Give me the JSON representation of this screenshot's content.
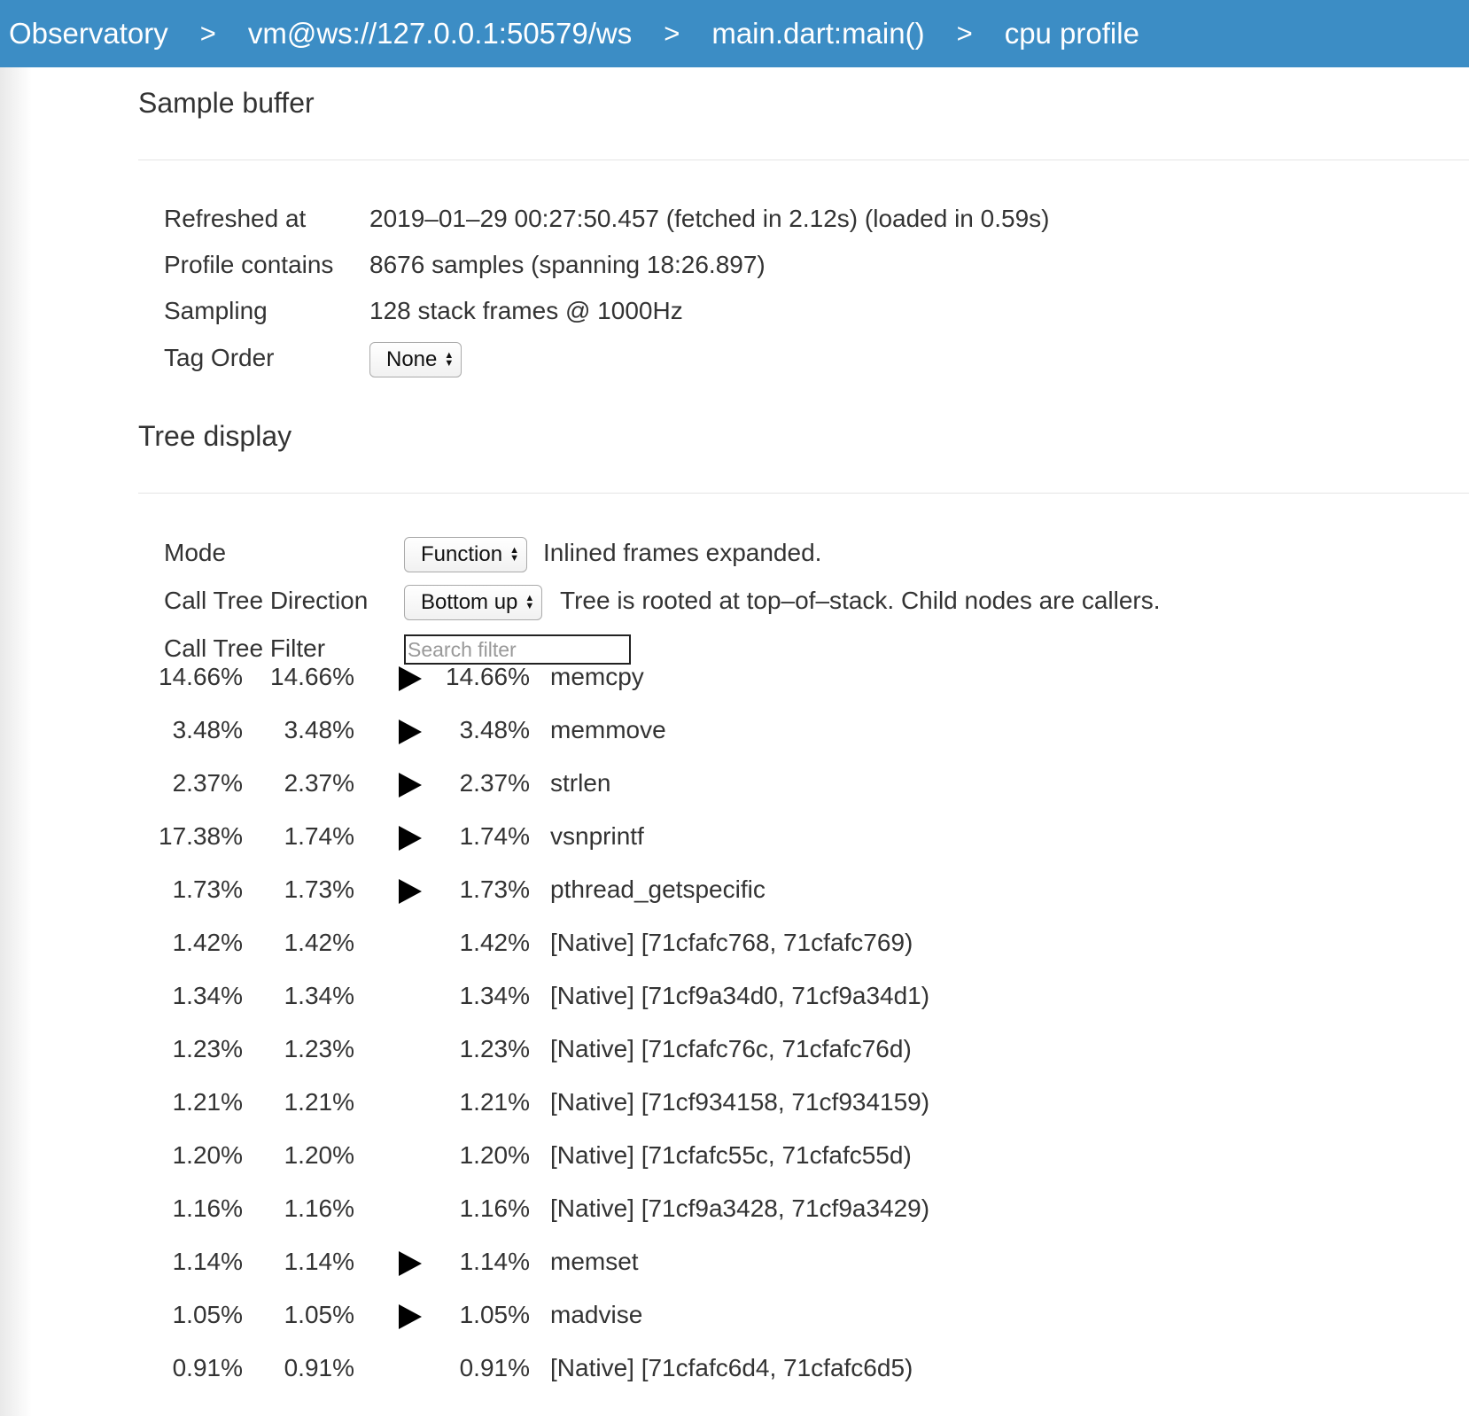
{
  "breadcrumb": {
    "items": [
      "Observatory",
      "vm@ws://127.0.0.1:50579/ws",
      "main.dart:main()",
      "cpu profile"
    ],
    "separator": ">"
  },
  "sample_buffer": {
    "title": "Sample buffer",
    "refreshed_label": "Refreshed at",
    "refreshed_value": "2019–01–29 00:27:50.457 (fetched in 2.12s) (loaded in 0.59s)",
    "contains_label": "Profile contains",
    "contains_value": "8676 samples (spanning 18:26.897)",
    "sampling_label": "Sampling",
    "sampling_value": "128 stack frames @ 1000Hz",
    "tag_order_label": "Tag Order",
    "tag_order_value": "None"
  },
  "tree_display": {
    "title": "Tree display",
    "mode_label": "Mode",
    "mode_value": "Function",
    "mode_note": "Inlined frames expanded.",
    "direction_label": "Call Tree Direction",
    "direction_value": "Bottom up",
    "direction_note": "Tree is rooted at top–of–stack. Child nodes are callers.",
    "filter_label": "Call Tree Filter",
    "filter_placeholder": "Search filter",
    "filter_value": ""
  },
  "tree_rows": [
    {
      "inclusive": "14.66%",
      "exclusive": "14.66%",
      "expandable": true,
      "self": "14.66%",
      "name": "memcpy"
    },
    {
      "inclusive": "3.48%",
      "exclusive": "3.48%",
      "expandable": true,
      "self": "3.48%",
      "name": "memmove"
    },
    {
      "inclusive": "2.37%",
      "exclusive": "2.37%",
      "expandable": true,
      "self": "2.37%",
      "name": "strlen"
    },
    {
      "inclusive": "17.38%",
      "exclusive": "1.74%",
      "expandable": true,
      "self": "1.74%",
      "name": "vsnprintf"
    },
    {
      "inclusive": "1.73%",
      "exclusive": "1.73%",
      "expandable": true,
      "self": "1.73%",
      "name": "pthread_getspecific"
    },
    {
      "inclusive": "1.42%",
      "exclusive": "1.42%",
      "expandable": false,
      "self": "1.42%",
      "name": "[Native] [71cfafc768, 71cfafc769)"
    },
    {
      "inclusive": "1.34%",
      "exclusive": "1.34%",
      "expandable": false,
      "self": "1.34%",
      "name": "[Native] [71cf9a34d0, 71cf9a34d1)"
    },
    {
      "inclusive": "1.23%",
      "exclusive": "1.23%",
      "expandable": false,
      "self": "1.23%",
      "name": "[Native] [71cfafc76c, 71cfafc76d)"
    },
    {
      "inclusive": "1.21%",
      "exclusive": "1.21%",
      "expandable": false,
      "self": "1.21%",
      "name": "[Native] [71cf934158, 71cf934159)"
    },
    {
      "inclusive": "1.20%",
      "exclusive": "1.20%",
      "expandable": false,
      "self": "1.20%",
      "name": "[Native] [71cfafc55c, 71cfafc55d)"
    },
    {
      "inclusive": "1.16%",
      "exclusive": "1.16%",
      "expandable": false,
      "self": "1.16%",
      "name": "[Native] [71cf9a3428, 71cf9a3429)"
    },
    {
      "inclusive": "1.14%",
      "exclusive": "1.14%",
      "expandable": true,
      "self": "1.14%",
      "name": "memset"
    },
    {
      "inclusive": "1.05%",
      "exclusive": "1.05%",
      "expandable": true,
      "self": "1.05%",
      "name": "madvise"
    },
    {
      "inclusive": "0.91%",
      "exclusive": "0.91%",
      "expandable": false,
      "self": "0.91%",
      "name": "[Native] [71cfafc6d4, 71cfafc6d5)"
    }
  ],
  "colors": {
    "topbar": "#3c8dc5"
  }
}
